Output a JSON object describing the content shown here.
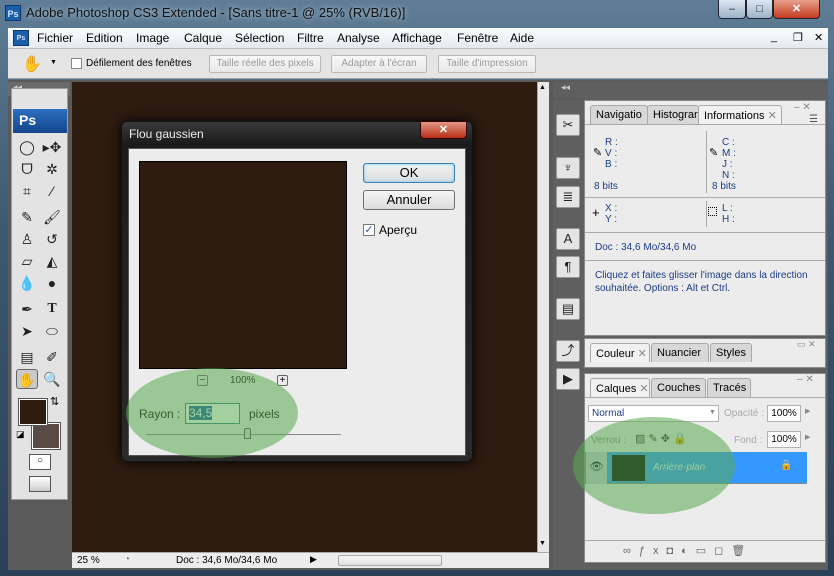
{
  "window": {
    "title": "Adobe Photoshop CS3 Extended - [Sans titre-1 @ 25% (RVB/16)]",
    "app_icon": "Ps",
    "minimize": "–",
    "maximize": "□",
    "close": "✕"
  },
  "menu": [
    "Fichier",
    "Edition",
    "Image",
    "Calque",
    "Sélection",
    "Filtre",
    "Analyse",
    "Affichage",
    "Fenêtre",
    "Aide"
  ],
  "doc_controls": {
    "minimize": "_",
    "restore": "❐",
    "close": "✕"
  },
  "options": {
    "scroll_all_windows": "Défilement des fenêtres",
    "scroll_all_checked": false,
    "actual_pixels": "Taille réelle des pixels",
    "fit_screen": "Adapter à l'écran",
    "print_size": "Taille d'impression"
  },
  "toolbox": {
    "logo": "Ps",
    "foreground": "#2e1c10",
    "background": "#5a4a45"
  },
  "status": {
    "zoom": "25 %",
    "doc": "Doc : 34,6 Mo/34,6 Mo"
  },
  "info_panel": {
    "tabs": [
      "Navigatio",
      "Histogran",
      "Informations"
    ],
    "rgb": [
      "R :",
      "V :",
      "B :"
    ],
    "cmyk": [
      "C :",
      "M :",
      "J :",
      "N :"
    ],
    "bits_left": "8 bits",
    "bits_right": "8 bits",
    "xy": [
      "X :",
      "Y :"
    ],
    "lh": [
      "L :",
      "H :"
    ],
    "doc": "Doc : 34,6 Mo/34,6 Mo",
    "hint": "Cliquez et faites glisser l'image dans la direction souhaitée. Options : Alt et Ctrl."
  },
  "color_panel": {
    "tabs": [
      "Couleur",
      "Nuancier",
      "Styles"
    ]
  },
  "layers_panel": {
    "tabs": [
      "Calques",
      "Couches",
      "Tracés"
    ],
    "blend_mode": "Normal",
    "opacity_label": "Opacité :",
    "opacity": "100%",
    "lock_label": "Verrou :",
    "fill_label": "Fond :",
    "fill": "100%",
    "layers": [
      {
        "name": "Arrière-plan",
        "visible": true,
        "locked": true
      }
    ]
  },
  "dialog": {
    "title": "Flou gaussien",
    "ok": "OK",
    "cancel": "Annuler",
    "preview_label": "Aperçu",
    "preview_checked": true,
    "zoom": "100%",
    "zoom_out": "−",
    "zoom_in": "+",
    "radius_label": "Rayon :",
    "radius": "34,5",
    "unit": "pixels",
    "slider_percent": 52,
    "preview_color": "#2e1c10"
  }
}
